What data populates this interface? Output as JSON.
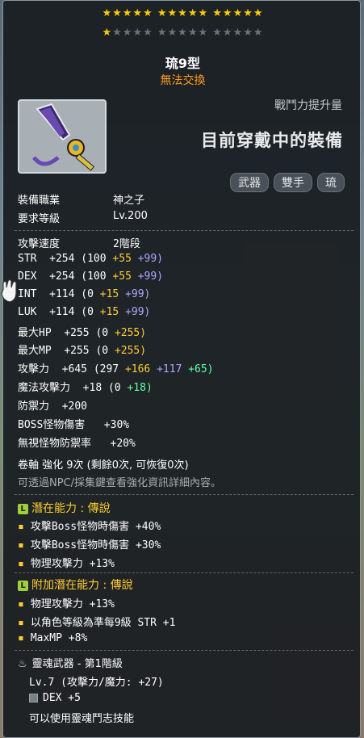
{
  "stars": {
    "row1": "★★★★★ ★★★★★ ★★★★★",
    "row2_filled": "★",
    "row2_empty": "★★★★ ★★★★★ ★★★★★"
  },
  "item": {
    "name": "琉9型",
    "trade": "無法交換",
    "icon": "sword-weapon-icon"
  },
  "header": {
    "power_label": "戰鬥力提升量",
    "equipped_label": "目前穿戴中的裝備",
    "tags": [
      "武器",
      "雙手",
      "琉"
    ]
  },
  "req": {
    "job_label": "裝備職業",
    "job": "神之子",
    "level_label": "要求等級",
    "level": "Lv.200"
  },
  "stats": {
    "speed_label": "攻擊速度",
    "speed": "2階段",
    "str": {
      "label": "STR",
      "total": "+254",
      "base": "(100",
      "a": "+55",
      "b": "+99)"
    },
    "dex": {
      "label": "DEX",
      "total": "+254",
      "base": "(100",
      "a": "+55",
      "b": "+99)"
    },
    "int": {
      "label": "INT",
      "total": "+114",
      "base": "(0",
      "a": "+15",
      "b": "+99)"
    },
    "luk": {
      "label": "LUK",
      "total": "+114",
      "base": "(0",
      "a": "+15",
      "b": "+99)"
    },
    "hp": {
      "label": "最大HP",
      "total": "+255",
      "base": "(0",
      "a": "+255)"
    },
    "mp": {
      "label": "最大MP",
      "total": "+255",
      "base": "(0",
      "a": "+255)"
    },
    "atk": {
      "label": "攻擊力",
      "total": "+645",
      "base": "(297",
      "a": "+166",
      "b": "+117",
      "c": "+65)"
    },
    "matk": {
      "label": "魔法攻擊力",
      "total": "+18",
      "base": "(0",
      "c": "+18)"
    },
    "def": {
      "label": "防禦力",
      "total": "+200"
    },
    "boss": {
      "label": "BOSS怪物傷害",
      "total": "+30%"
    },
    "ied": {
      "label": "無視怪物防禦率",
      "total": "+20%"
    }
  },
  "upgrade": {
    "text": "卷軸 強化 9次 (剩餘0次, 可恢復0次)",
    "hint": "可透過NPC/採集鍵查看強化資訊詳細內容。"
  },
  "potential": {
    "badge": "L",
    "title": "潛在能力 : 傳說",
    "lines": [
      "攻擊Boss怪物時傷害 +40%",
      "攻擊Boss怪物時傷害 +30%",
      "物理攻擊力 +13%"
    ]
  },
  "bonus": {
    "badge": "L",
    "title": "附加潛在能力 : 傳說",
    "lines": [
      "物理攻擊力 +13%",
      "以角色等級為準每9級 STR +1",
      "MaxMP +8%"
    ]
  },
  "soul": {
    "title": "靈魂武器 - 第1階級",
    "level": "Lv.7 (攻擊力/魔力: +27)",
    "stat": "DEX +5",
    "skill": "可以使用靈魂鬥志技能"
  }
}
